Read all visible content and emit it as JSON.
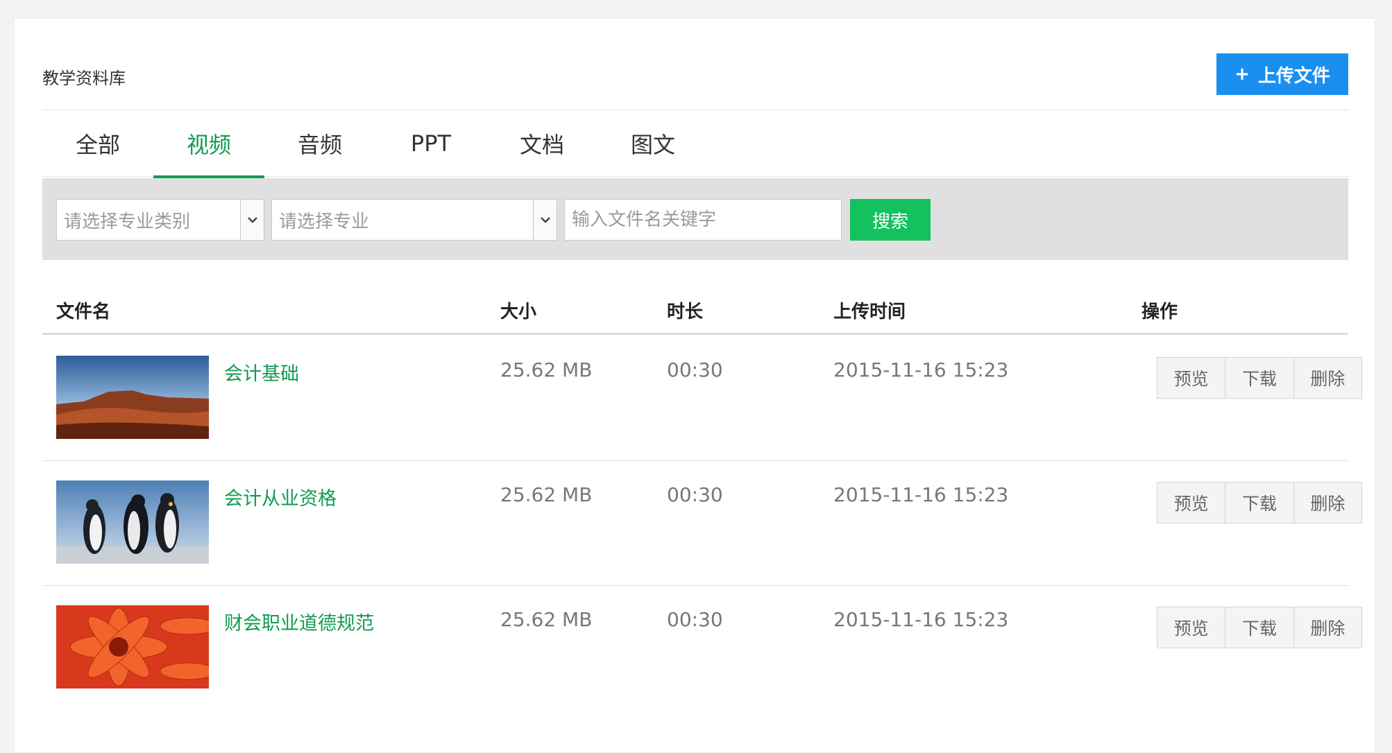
{
  "header": {
    "title": "教学资料库",
    "upload_label": "上传文件",
    "upload_icon": "+",
    "accent_color": "#1a8ff0"
  },
  "tabs": [
    {
      "label": "全部",
      "active": false
    },
    {
      "label": "视频",
      "active": true
    },
    {
      "label": "音频",
      "active": false
    },
    {
      "label": "PPT",
      "active": false
    },
    {
      "label": "文档",
      "active": false
    },
    {
      "label": "图文",
      "active": false
    }
  ],
  "filters": {
    "category_placeholder": "请选择专业类别",
    "major_placeholder": "请选择专业",
    "search_placeholder": "输入文件名关键字",
    "search_label": "搜索"
  },
  "table": {
    "columns": [
      "文件名",
      "大小",
      "时长",
      "上传时间",
      "操作"
    ],
    "rows": [
      {
        "name": "会计基础",
        "size": "25.62 MB",
        "duration": "00:30",
        "uploaded": "2015-11-16 15:23",
        "thumb": "desert-landscape"
      },
      {
        "name": "会计从业资格",
        "size": "25.62 MB",
        "duration": "00:30",
        "uploaded": "2015-11-16 15:23",
        "thumb": "penguins"
      },
      {
        "name": "财会职业道德规范",
        "size": "25.62 MB",
        "duration": "00:30",
        "uploaded": "2015-11-16 15:23",
        "thumb": "red-flower"
      }
    ],
    "actions": {
      "preview": "预览",
      "download": "下载",
      "delete": "删除"
    }
  }
}
